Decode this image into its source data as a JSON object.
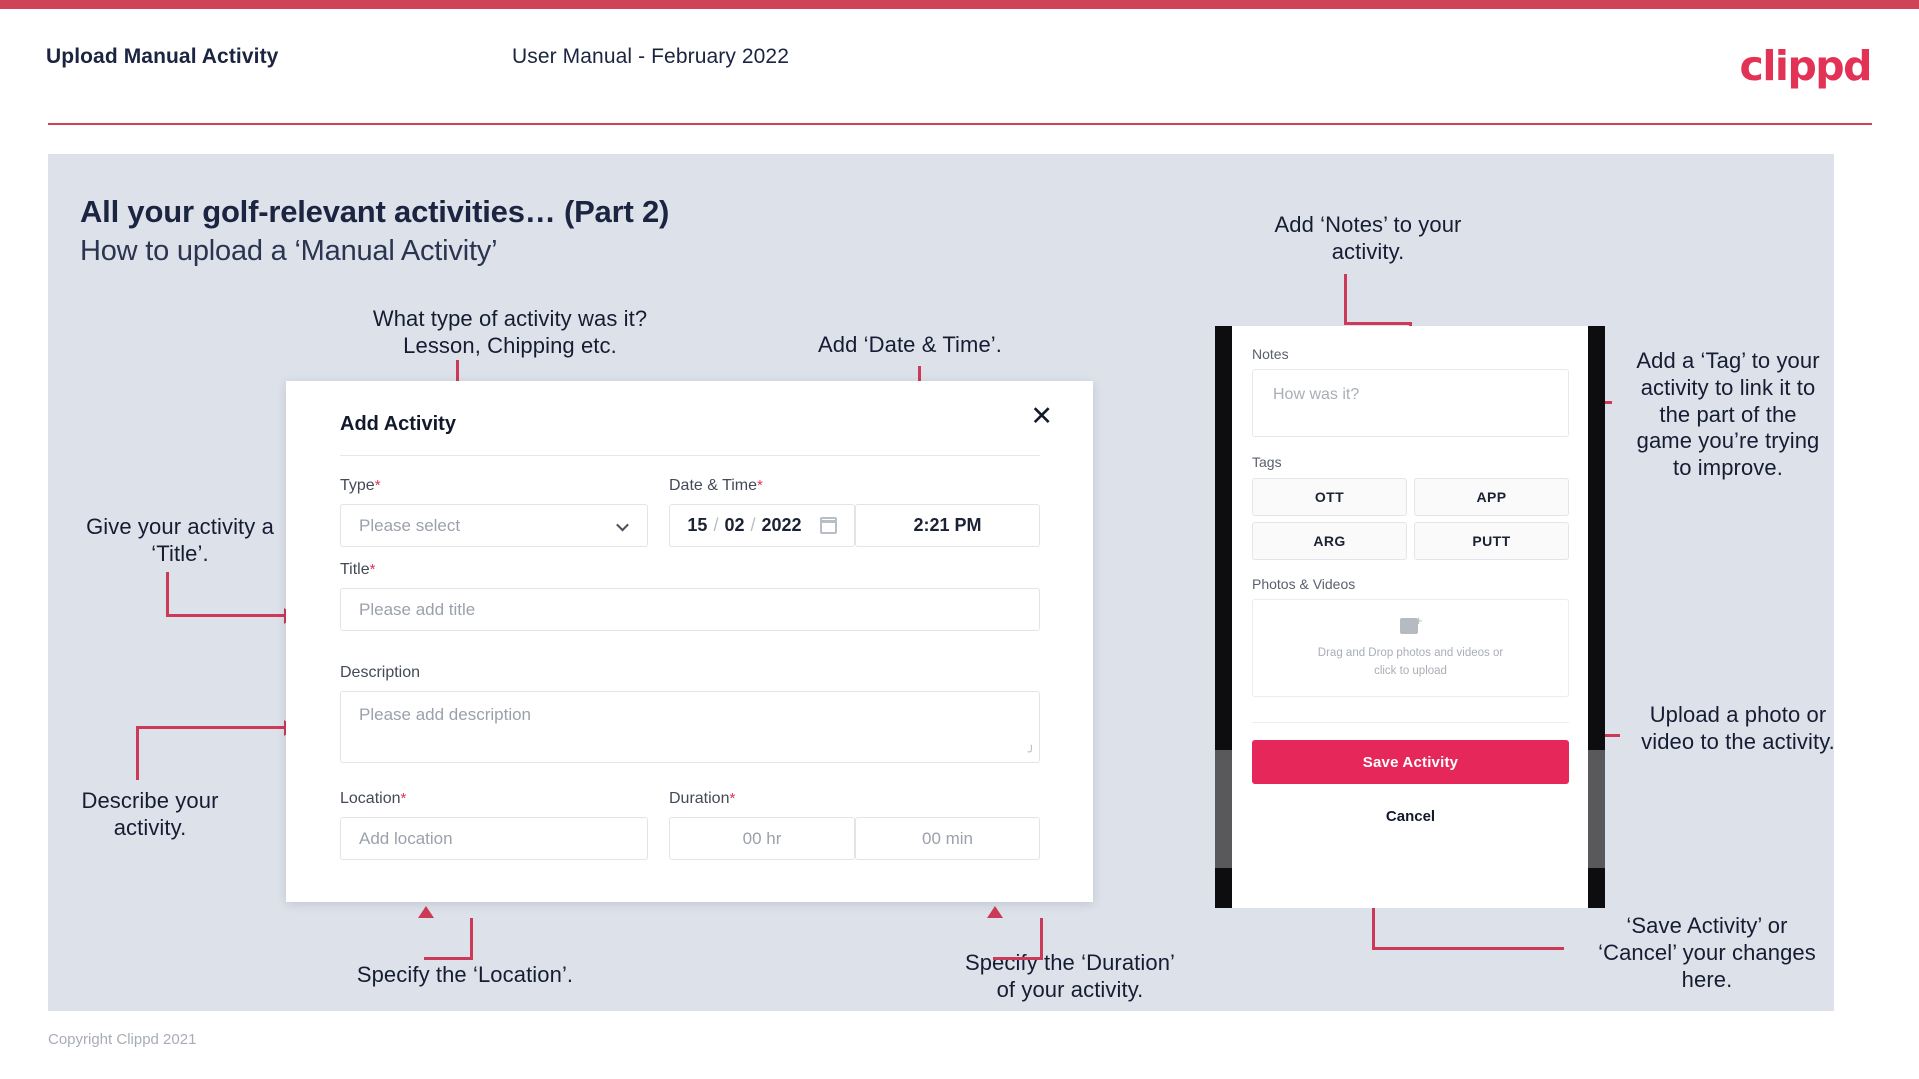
{
  "header": {
    "title": "Upload Manual Activity",
    "subtitle": "User Manual - February 2022",
    "logo": "clippd"
  },
  "slide": {
    "heading": "All your golf-relevant activities… (Part 2)",
    "subheading": "How to upload a ‘Manual Activity’"
  },
  "annotations": {
    "type": "What type of activity was it?\nLesson, Chipping etc.",
    "datetime": "Add ‘Date & Time’.",
    "title": "Give your activity a\n‘Title’.",
    "description": "Describe your\nactivity.",
    "location": "Specify the ‘Location’.",
    "duration": "Specify the ‘Duration’\nof your activity.",
    "notes": "Add ‘Notes’ to your\nactivity.",
    "tag": "Add a ‘Tag’ to your\nactivity to link it to\nthe part of the\ngame you’re trying\nto improve.",
    "upload": "Upload a photo or\nvideo to the activity.",
    "save": "‘Save Activity’ or\n‘Cancel’ your changes\nhere."
  },
  "dialog": {
    "title": "Add Activity",
    "close_icon": "close-icon",
    "fields": {
      "type": {
        "label": "Type",
        "required": "*",
        "placeholder": "Please select"
      },
      "datetime": {
        "label": "Date & Time",
        "required": "*",
        "day": "15",
        "month": "02",
        "year": "2022",
        "sep": "/",
        "time": "2:21 PM",
        "calendar_icon": "calendar-icon"
      },
      "title": {
        "label": "Title",
        "required": "*",
        "placeholder": "Please add title"
      },
      "description": {
        "label": "Description",
        "required": "",
        "placeholder": "Please add description"
      },
      "location": {
        "label": "Location",
        "required": "*",
        "placeholder": "Add location"
      },
      "duration": {
        "label": "Duration",
        "required": "*",
        "hours": "00 hr",
        "minutes": "00 min"
      }
    }
  },
  "phone": {
    "notes": {
      "label": "Notes",
      "placeholder": "How was it?"
    },
    "tags": {
      "label": "Tags",
      "items": [
        "OTT",
        "APP",
        "ARG",
        "PUTT"
      ]
    },
    "photos": {
      "label": "Photos & Videos",
      "icon": "add-image-icon",
      "line1": "Drag and Drop photos and videos or",
      "line2": "click to upload"
    },
    "save_label": "Save Activity",
    "cancel_label": "Cancel"
  },
  "footer": {
    "copyright": "Copyright Clippd 2021"
  },
  "colors": {
    "brand_red": "#e23255",
    "accent_line": "#cd3a57",
    "slide_bg": "#dde2ea",
    "save_button": "#e6275a",
    "text_dark": "#1b2440"
  }
}
